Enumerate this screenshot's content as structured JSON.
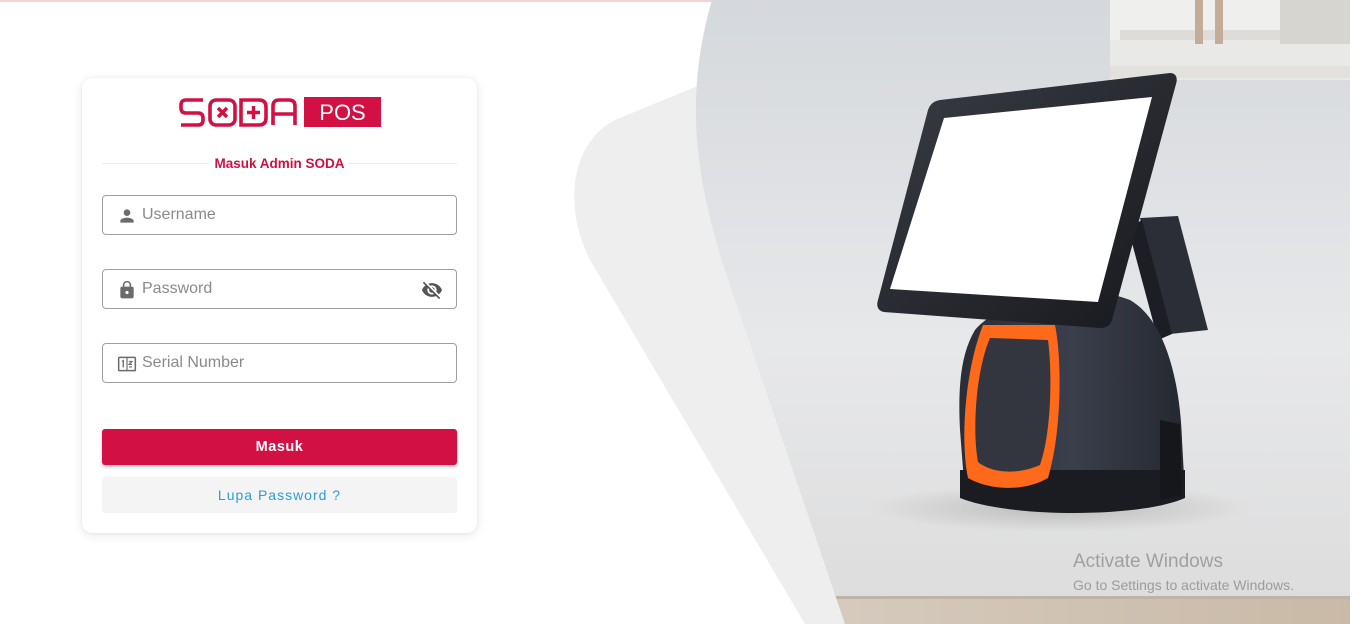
{
  "brand": {
    "logo_word": "SODA",
    "logo_tag": "POS",
    "accent_color": "#d21043"
  },
  "login": {
    "title": "Masuk Admin SODA",
    "username": {
      "placeholder": "Username",
      "value": "",
      "icon": "person-icon"
    },
    "password": {
      "placeholder": "Password",
      "value": "",
      "icon": "lock-icon",
      "toggle_icon": "eye-off-icon"
    },
    "serial": {
      "placeholder": "Serial Number",
      "value": "",
      "icon": "serial-number-icon"
    },
    "submit_label": "Masuk",
    "forgot_label": "Lupa Password ?",
    "link_color": "#2f9bd6"
  },
  "hero": {
    "image": "pos-terminal-image"
  },
  "watermark": {
    "title": "Activate Windows",
    "subtitle": "Go to Settings to activate Windows."
  }
}
